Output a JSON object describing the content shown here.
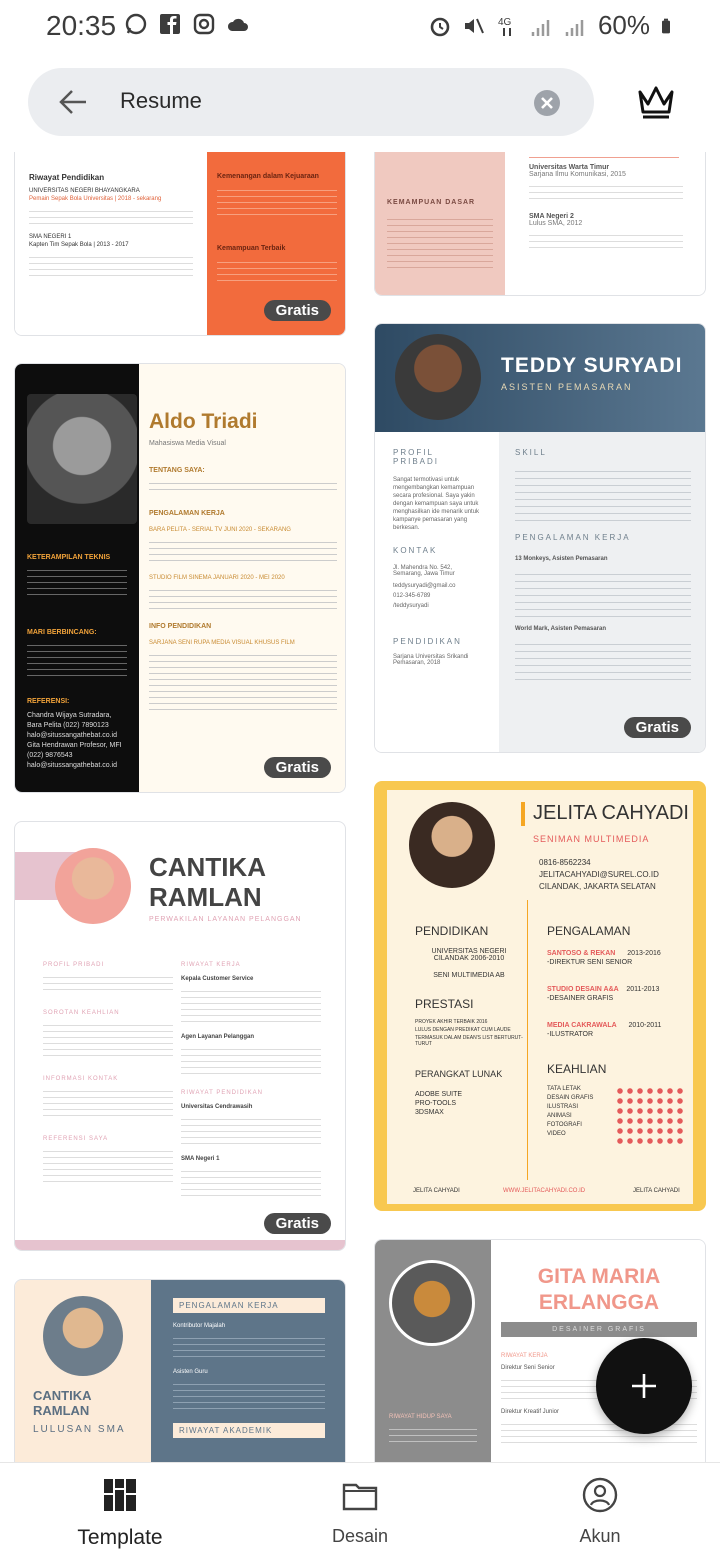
{
  "status_bar": {
    "time": "20:35",
    "battery": "60%",
    "icons": [
      "whatsapp-icon",
      "facebook-icon",
      "instagram-icon",
      "cloud-icon",
      "alarm-icon",
      "mute-icon",
      "network-4g-icon",
      "signal-icon",
      "signal-icon",
      "battery-icon"
    ]
  },
  "search": {
    "query": "Resume"
  },
  "cards": {
    "badge": "Gratis",
    "c1": {
      "h1": "Riwayat Pendidikan",
      "t1": "UNIVERSITAS NEGERI BHAYANGKARA",
      "t2": "Pemain Sepak Bola Universitas | 2018 - sekarang",
      "t3": "SMA NEGERI 1",
      "t4": "Kapten Tim Sepak Bola | 2013 - 2017",
      "r1": "Kemenangan dalam Kejuaraan",
      "r2": "Kemampuan Terbaik"
    },
    "c2": {
      "h1": "KEMAMPUAN DASAR",
      "t1": "Universitas Warta Timur",
      "t2": "Sarjana Ilmu Komunikasi, 2015",
      "t3": "SMA Negeri 2",
      "t4": "Lulus SMA, 2012"
    },
    "c3": {
      "name": "Aldo Triadi",
      "role": "Mahasiswa Media Visual",
      "s1": "TENTANG SAYA:",
      "s2": "PENGALAMAN KERJA",
      "j1": "BARA PELITA - SERIAL TV JUNI 2020 - SEKARANG",
      "j2": "STUDIO FILM SINEMA JANUARI 2020 - MEI 2020",
      "s3": "INFO PENDIDIKAN",
      "j3": "SARJANA SENI RUPA MEDIA VISUAL KHUSUS FILM",
      "l1": "KETERAMPILAN TEKNIS",
      "l2": "MARI BERBINCANG:",
      "l3": "REFERENSI:",
      "ref": "Chandra Wijaya Sutradara, Bara Pelita (022) 7890123 halo@situssangathebat.co.id Gita Hendrawan Profesor, MFI (022) 9876543 halo@situssangathebat.co.id"
    },
    "c4": {
      "name": "TEDDY SURYADI",
      "role": "ASISTEN PEMASARAN",
      "l1": "PROFIL PRIBADI",
      "l1t": "Sangat termotivasi untuk mengembangkan kemampuan secara profesional. Saya yakin dengan kemampuan saya untuk menghasilkan ide menarik untuk kampanye pemasaran yang berkesan.",
      "l2": "KONTAK",
      "addr": "Jl. Mahendra No. 542, Semarang, Jawa Timur",
      "email": "teddysuryadi@gmail.co",
      "phone": "012-345-6789",
      "web": "/teddysuryadi",
      "l3": "PENDIDIKAN",
      "edu": "Sarjana Universitas Srikandi Pemasaran, 2018",
      "r1": "SKILL",
      "r2": "PENGALAMAN KERJA",
      "j1": "13 Monkeys, Asisten Pemasaran",
      "j2": "World Mark, Asisten Pemasaran"
    },
    "c5": {
      "name": "CANTIKA RAMLAN",
      "role": "PERWAKILAN LAYANAN PELANGGAN",
      "l1": "PROFIL PRIBADI",
      "l2": "SOROTAN KEAHLIAN",
      "l3": "INFORMASI KONTAK",
      "l4": "REFERENSI SAYA",
      "r1": "RIWAYAT KERJA",
      "r1a": "Kepala Customer Service",
      "r1b": "Agen Layanan Pelanggan",
      "r2": "RIWAYAT PENDIDIKAN",
      "r2a": "Universitas Cendrawasih",
      "r2b": "SMA Negeri 1"
    },
    "c6": {
      "name": "JELITA CAHYADI",
      "role": "SENIMAN MULTIMEDIA",
      "phone": "0816-8562234",
      "email": "JELITACAHYADI@SUREL.CO.ID",
      "addr": "CILANDAK, JAKARTA SELATAN",
      "s1": "PENDIDIKAN",
      "s1a": "UNIVERSITAS NEGERI CILANDAK 2006-2010",
      "s1b": "SENI MULTIMEDIA AB",
      "s2": "PRESTASI",
      "s2a": "PROYEK AKHIR TERBAIK 2016",
      "s2b": "LULUS DENGAN PREDIKAT CUM LAUDE",
      "s2c": "TERMASUK DALAM DEAN'S LIST BERTURUT-TURUT",
      "s3": "PERANGKAT LUNAK",
      "sw": [
        "ADOBE SUITE",
        "PRO-TOOLS",
        "3DSMAX"
      ],
      "e1": "PENGALAMAN",
      "e1a": "SANTOSO & REKAN",
      "e1ay": "2013-2016",
      "e1ar": "-DIREKTUR SENI SENIOR",
      "e1b": "STUDIO DESAIN A&A",
      "e1by": "2011-2013",
      "e1br": "-DESAINER GRAFIS",
      "e1c": "MEDIA CAKRAWALA",
      "e1cy": "2010-2011",
      "e1cr": "-ILUSTRATOR",
      "e2": "KEAHLIAN",
      "skills": [
        "TATA LETAK",
        "DESAIN GRAFIS",
        "ILUSTRASI",
        "ANIMASI",
        "FOTOGRAFI",
        "VIDEO"
      ],
      "f1": "JELITA CAHYADI",
      "f2": "WWW.JELITACAHYADI.CO.ID",
      "f3": "JELITA CAHYADI"
    },
    "c7": {
      "name1": "CANTIKA",
      "name2": "RAMLAN",
      "role": "LULUSAN SMA",
      "s1": "PENGALAMAN KERJA",
      "s1a": "Kontributor Majalah",
      "s1b": "Asisten Guru",
      "s2": "RIWAYAT AKADEMIK"
    },
    "c8": {
      "name": "GITA MARIA ERLANGGA",
      "role": "DESAINER GRAFIS",
      "s1": "RIWAYAT KERJA",
      "s1a": "Direktur Seni Senior",
      "s1b": "Direktur Kreatif Junior",
      "l1": "RIWAYAT HIDUP SAYA"
    }
  },
  "nav": {
    "template": "Template",
    "desain": "Desain",
    "akun": "Akun"
  }
}
